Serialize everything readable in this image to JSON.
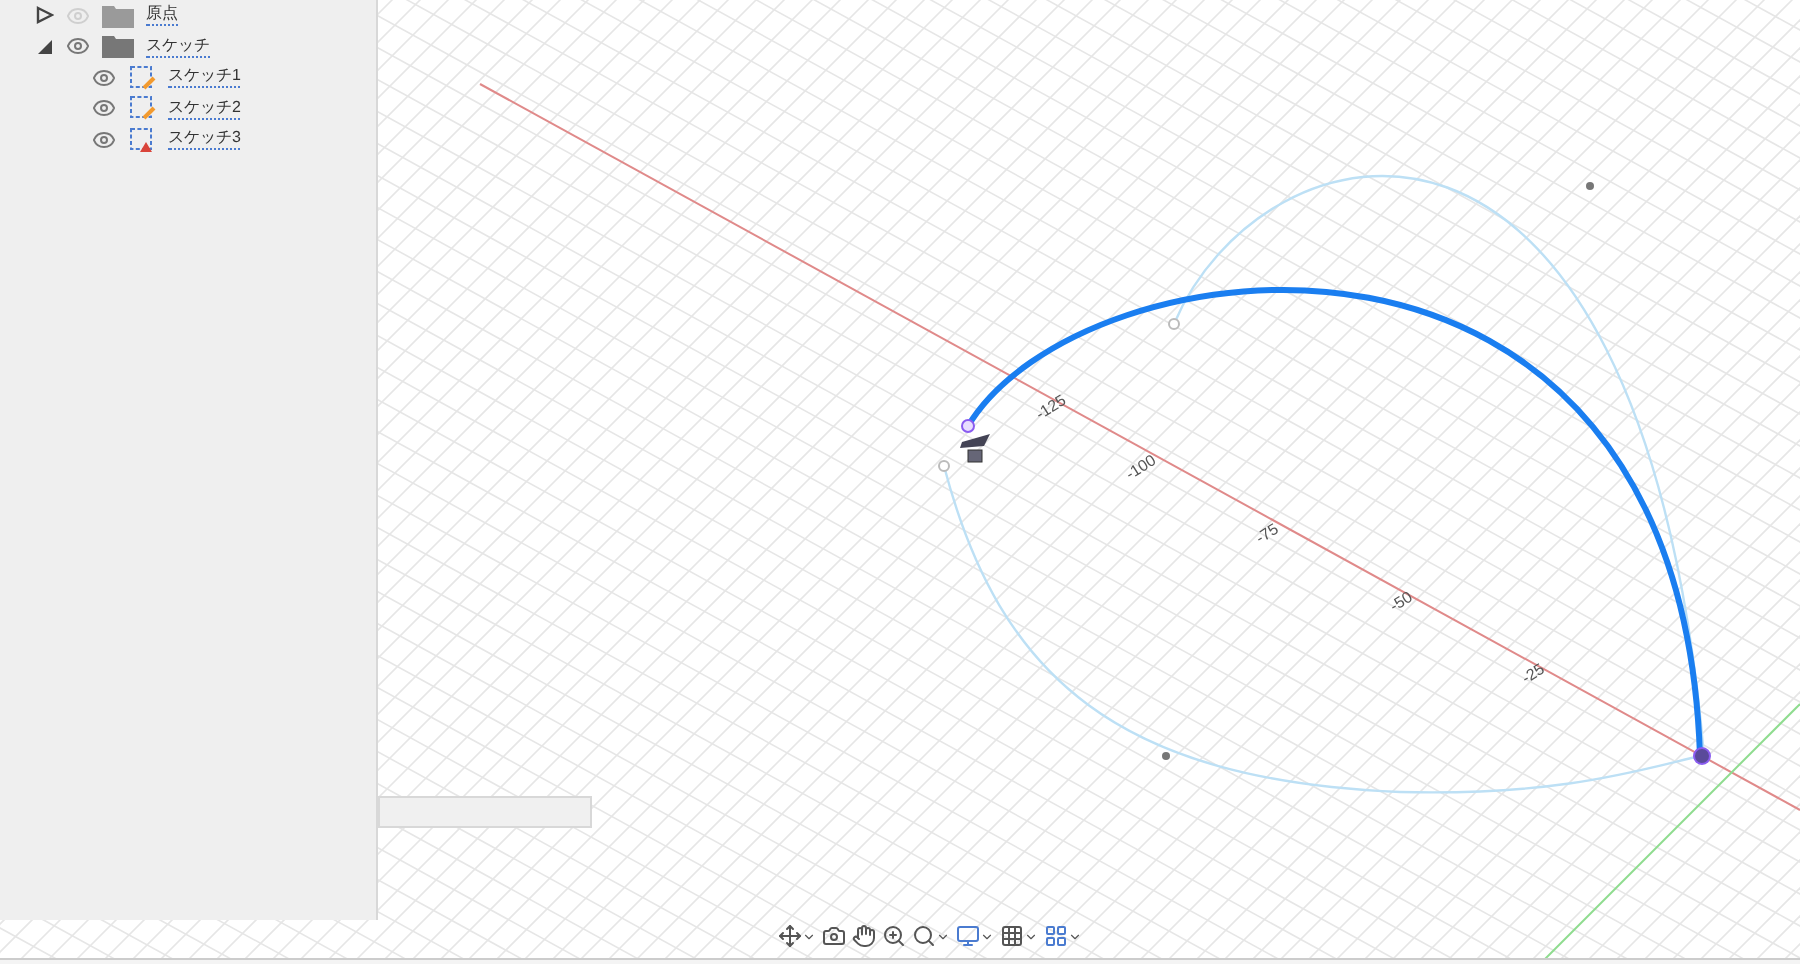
{
  "browser": {
    "items": [
      {
        "label": "原点",
        "kind": "origin",
        "expanded": false,
        "visible": false
      },
      {
        "label": "スケッチ",
        "kind": "folder",
        "expanded": true,
        "visible": true,
        "children": [
          {
            "label": "スケッチ1",
            "kind": "sketch",
            "visible": true
          },
          {
            "label": "スケッチ2",
            "kind": "sketch",
            "visible": true
          },
          {
            "label": "スケッチ3",
            "kind": "sketch-warning",
            "visible": true
          }
        ]
      }
    ]
  },
  "viewport": {
    "axis_labels": [
      "-125",
      "-100",
      "-75",
      "-50",
      "-25"
    ]
  },
  "toolbar": [
    {
      "kind": "orbit",
      "dropdown": true
    },
    {
      "kind": "look",
      "dropdown": false
    },
    {
      "kind": "pan",
      "dropdown": false
    },
    {
      "kind": "zoom",
      "dropdown": false
    },
    {
      "kind": "fit",
      "dropdown": true
    },
    {
      "kind": "display",
      "dropdown": true
    },
    {
      "kind": "grid",
      "dropdown": true
    },
    {
      "kind": "viewports",
      "dropdown": true
    }
  ]
}
